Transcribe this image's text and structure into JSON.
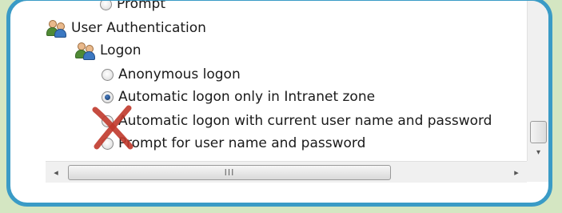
{
  "tree": {
    "partial_top_label": "Prompt",
    "group_label": "User Authentication",
    "subgroup_label": "Logon",
    "options": [
      {
        "label": "Anonymous logon",
        "checked": false
      },
      {
        "label": "Automatic logon only in Intranet zone",
        "checked": true
      },
      {
        "label": "Automatic logon with current user name and password",
        "checked": false
      },
      {
        "label": "Prompt for user name and password",
        "checked": false
      }
    ]
  },
  "scrollbars": {
    "hthumb_grip": "III",
    "left_arrow": "◂",
    "right_arrow": "▸",
    "down_arrow": "▾"
  },
  "icons": {
    "users": "users-icon",
    "annotation": "red-x-icon"
  },
  "colors": {
    "frame_border": "#3a9bc6",
    "background": "#d4e6c2",
    "annotation_red": "#c0392b"
  }
}
